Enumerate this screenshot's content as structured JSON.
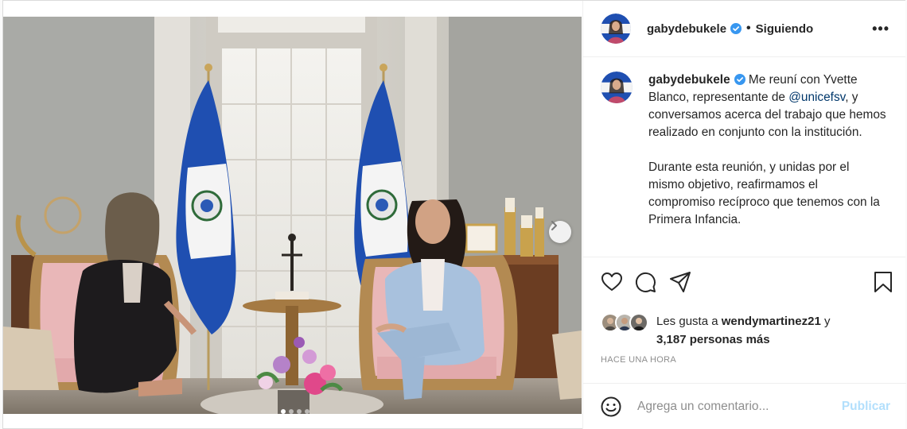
{
  "post": {
    "username": "gabydebukele",
    "follow_separator": "•",
    "follow_status": "Siguiendo",
    "more_label": "•••",
    "caption": {
      "username": "gabydebukele",
      "para1_a": "Me reuní con Yvette Blanco, representante de",
      "mention": "@unicefsv",
      "para1_b": ", y conversamos acerca del trabajo que hemos realizado en conjunto con la institución.",
      "para2": "Durante esta reunión, y unidas por el mismo objetivo, reafirmamos el compromiso recíproco que tenemos con la Primera Infancia."
    },
    "likes": {
      "prefix": "Les gusta a",
      "liker": "wendymartinez21",
      "conj": "y",
      "others": "3,187 personas más"
    },
    "timestamp": "HACE UNA HORA",
    "comment": {
      "placeholder": "Agrega un comentario...",
      "publish_label": "Publicar"
    },
    "carousel": {
      "total": 4,
      "active": 1
    },
    "icons": {
      "like": "heart-icon",
      "comment": "comment-icon",
      "share": "share-icon",
      "save": "bookmark-icon",
      "emoji": "emoji-icon",
      "verified": "verified-badge-icon",
      "next": "chevron-right-icon"
    },
    "colors": {
      "link": "#00376b",
      "verified": "#3897f0",
      "publish_disabled": "#b2dffc",
      "muted": "#8e8e8e"
    }
  }
}
